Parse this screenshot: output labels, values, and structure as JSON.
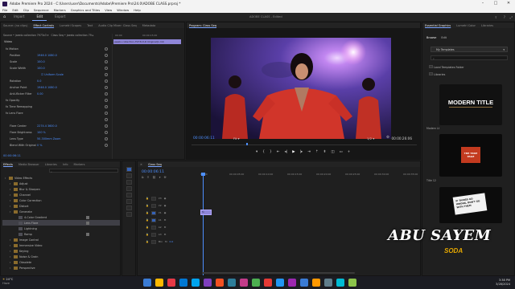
{
  "window": {
    "title": "Adobe Premiere Pro 2024 - C:\\Users\\user\\Documents\\Adobe\\Premiere Pro\\24.0\\ADOBE CLASS.prproj *"
  },
  "menu": [
    "File",
    "Edit",
    "Clip",
    "Sequence",
    "Markers",
    "Graphics and Titles",
    "View",
    "Window",
    "Help"
  ],
  "workspaces": {
    "items": [
      "Import",
      "Edit",
      "Export"
    ],
    "active": "Edit",
    "center_title": "ADOBE CLASS",
    "center_sub": "- Edited"
  },
  "effect_controls": {
    "tabs": [
      "Source: (no clips)",
      "Effect Controls",
      "Lumetri Scopes",
      "Text",
      "Audio Clip Mixer: Class Seq",
      "Metadata"
    ],
    "active_tab": "Effect Controls",
    "source_line": "Source • jaeelo collection 7973x3 ▾",
    "seq_line": "Class Seq • jaeelo collection 79 ▸",
    "time": "00:00",
    "time2": "00:00:15:00",
    "clip_label": "jaeelo-collection-7973x3-R Original]n.m4",
    "section_video": "Video",
    "props": [
      {
        "name": "fx  Motion",
        "value": "",
        "indent": 0
      },
      {
        "name": "Position",
        "value": "1946.0    1080.0",
        "indent": 1
      },
      {
        "name": "Scale",
        "value": "100.0",
        "indent": 1
      },
      {
        "name": "Scale Width",
        "value": "100.0",
        "indent": 1
      },
      {
        "name": "",
        "value": "☑ Uniform Scale",
        "indent": 2
      },
      {
        "name": "Rotation",
        "value": "0.0",
        "indent": 1
      },
      {
        "name": "Anchor Point",
        "value": "1946.0    1080.0",
        "indent": 1
      },
      {
        "name": "Anti-flicker Filter",
        "value": "0.00",
        "indent": 1
      },
      {
        "name": "fx  Opacity",
        "value": "",
        "indent": 0
      },
      {
        "name": "fx  Time Remapping",
        "value": "",
        "indent": 0
      },
      {
        "name": "fx  Lens Flare",
        "value": "",
        "indent": 0
      },
      {
        "name": "",
        "value": "",
        "indent": 1
      },
      {
        "name": "Flare Center",
        "value": "2274.4    3600.0",
        "indent": 1
      },
      {
        "name": "Flare Brightness",
        "value": "100 %",
        "indent": 1
      },
      {
        "name": "Lens Type",
        "value": "50-300mm Zoom",
        "indent": 1
      },
      {
        "name": "Blend With Original",
        "value": "0 %",
        "indent": 1
      }
    ]
  },
  "program": {
    "tab": "Program: Class Seq",
    "timecode": "00:00:06:11",
    "fit": "Fit",
    "quality": "1/2",
    "duration": "00:00:26:06"
  },
  "effects": {
    "tabs": [
      "Effects",
      "Media Browser",
      "Libraries",
      "Info",
      "Markers"
    ],
    "active_tab": "Effects",
    "tree": [
      {
        "label": "Video Effects",
        "depth": 0,
        "badge": false,
        "sel": false
      },
      {
        "label": "Adjust",
        "depth": 1,
        "badge": false,
        "sel": false
      },
      {
        "label": "Blur & Sharpen",
        "depth": 1,
        "badge": false,
        "sel": false
      },
      {
        "label": "Channel",
        "depth": 1,
        "badge": false,
        "sel": false
      },
      {
        "label": "Color Correction",
        "depth": 1,
        "badge": false,
        "sel": false
      },
      {
        "label": "Distort",
        "depth": 1,
        "badge": false,
        "sel": false
      },
      {
        "label": "Generate",
        "depth": 1,
        "badge": false,
        "sel": false
      },
      {
        "label": "4-Color Gradient",
        "depth": 2,
        "badge": true,
        "sel": false
      },
      {
        "label": "Lens Flare",
        "depth": 2,
        "badge": true,
        "sel": true
      },
      {
        "label": "Lightning",
        "depth": 2,
        "badge": false,
        "sel": false
      },
      {
        "label": "Ramp",
        "depth": 2,
        "badge": true,
        "sel": false
      },
      {
        "label": "Image Control",
        "depth": 1,
        "badge": false,
        "sel": false
      },
      {
        "label": "Immersive Video",
        "depth": 1,
        "badge": false,
        "sel": false
      },
      {
        "label": "Keying",
        "depth": 1,
        "badge": false,
        "sel": false
      },
      {
        "label": "Noise & Grain",
        "depth": 1,
        "badge": false,
        "sel": false
      },
      {
        "label": "Obsolete",
        "depth": 1,
        "badge": false,
        "sel": false
      },
      {
        "label": "Perspective",
        "depth": 1,
        "badge": false,
        "sel": false
      }
    ]
  },
  "timeline": {
    "tab": "Class Seq",
    "timecode": "00:00:06:11",
    "ruler": [
      "00:00",
      "00:00:05:00",
      "00:00:10:00",
      "00:00:15:00",
      "00:00:20:00",
      "00:00:25:00",
      "00:00:30:00",
      "00:00:35:00"
    ],
    "tracks": [
      "V3",
      "V2",
      "V1",
      "A1",
      "A2",
      "A3",
      "Mix"
    ],
    "mix_value": "0.0",
    "clip_label": "fx"
  },
  "essential_graphics": {
    "tab": "Essential Graphics",
    "other_tabs": [
      "Lumetri Color",
      "Libraries"
    ],
    "sub_tabs": [
      "Browse",
      "Edit"
    ],
    "active_sub": "Browse",
    "dropdown": "My Templates",
    "check1": "Local Templates Folder",
    "check2": "Libraries",
    "card1_title": "MODERN TITLE",
    "card1_label": "Modern Lt",
    "card2_label": "Title 12",
    "card2_text": "THE TRUE PAGE",
    "card3_text": "IF THINGS GO WRONG, DON'T GO WITH THEM"
  },
  "watermark": {
    "name": "ABU SAYEM",
    "sub": "SODA"
  },
  "taskbar": {
    "weather_temp": "24°C",
    "weather_desc": "Haze",
    "time": "3:38 PM",
    "date": "3/28/2024",
    "icon_colors": [
      "#3a7bd5",
      "#ffb900",
      "#e63946",
      "#0078d4",
      "#00a4ef",
      "#7f3fbf",
      "#f25022",
      "#2d7d9a",
      "#c23b8a",
      "#4caf50",
      "#e53935",
      "#2196f3",
      "#9c27b0",
      "#3a7bd5",
      "#ff9800",
      "#607d8b",
      "#00bcd4",
      "#8bc34a"
    ]
  },
  "colors": {
    "accent": "#7aa4ff",
    "timecode": "#4d8fff",
    "clip_purple": "#8f86d8",
    "selected": "#3f3f46"
  }
}
